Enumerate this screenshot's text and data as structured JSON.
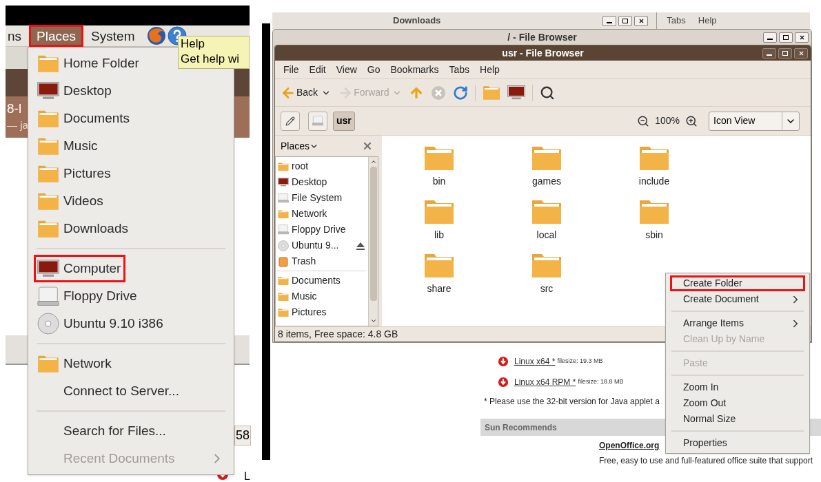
{
  "left_panel": {
    "top_bar": [
      {
        "label": "ns",
        "selected": false,
        "highlighted": false
      },
      {
        "label": "Places",
        "selected": true,
        "highlighted": true
      },
      {
        "label": "System",
        "selected": false,
        "highlighted": false
      }
    ],
    "tooltip": {
      "title": "Help",
      "text": "Get help wi"
    },
    "background": {
      "title_fragment": "8-l",
      "subtitle_fragment": "— ja",
      "number_fragment": "58",
      "letter_fragment": "L"
    },
    "places_menu": {
      "sections": [
        [
          {
            "label": "Home Folder",
            "highlighted": false,
            "disabled": false,
            "submenu": false
          },
          {
            "label": "Desktop",
            "highlighted": false,
            "disabled": false,
            "submenu": false
          },
          {
            "label": "Documents",
            "highlighted": false,
            "disabled": false,
            "submenu": false
          },
          {
            "label": "Music",
            "highlighted": false,
            "disabled": false,
            "submenu": false
          },
          {
            "label": "Pictures",
            "highlighted": false,
            "disabled": false,
            "submenu": false
          },
          {
            "label": "Videos",
            "highlighted": false,
            "disabled": false,
            "submenu": false
          },
          {
            "label": "Downloads",
            "highlighted": false,
            "disabled": false,
            "submenu": false
          }
        ],
        [
          {
            "label": "Computer",
            "highlighted": true,
            "disabled": false,
            "submenu": false
          },
          {
            "label": "Floppy Drive",
            "highlighted": false,
            "disabled": false,
            "submenu": false
          },
          {
            "label": "Ubuntu 9.10 i386",
            "highlighted": false,
            "disabled": false,
            "submenu": false
          }
        ],
        [
          {
            "label": "Network",
            "highlighted": false,
            "disabled": false,
            "submenu": false
          },
          {
            "label": "Connect to Server...",
            "highlighted": false,
            "disabled": false,
            "submenu": false
          }
        ],
        [
          {
            "label": "Search for Files...",
            "highlighted": false,
            "disabled": false,
            "submenu": false
          },
          {
            "label": "Recent Documents",
            "highlighted": false,
            "disabled": true,
            "submenu": true
          }
        ]
      ]
    }
  },
  "file_browser": {
    "background_window": {
      "title": "Downloads",
      "menu": [
        "Tabs",
        "Help"
      ]
    },
    "outer_window": {
      "title": "/ - File Browser"
    },
    "window": {
      "title": "usr - File Browser",
      "menu": [
        "File",
        "Edit",
        "View",
        "Go",
        "Bookmarks",
        "Tabs",
        "Help"
      ],
      "toolbar": [
        {
          "kind": "nav",
          "label": "Back",
          "disabled": false
        },
        {
          "kind": "nav",
          "label": "Forward",
          "disabled": true
        },
        {
          "kind": "icon",
          "disabled": false
        },
        {
          "kind": "icon",
          "disabled": true
        },
        {
          "kind": "icon",
          "disabled": false
        },
        {
          "kind": "separator"
        },
        {
          "kind": "icon",
          "disabled": false
        },
        {
          "kind": "icon",
          "disabled": false
        },
        {
          "kind": "separator"
        },
        {
          "kind": "icon",
          "disabled": false
        }
      ],
      "location": {
        "path": [
          {
            "kind": "drive",
            "selected": false
          },
          {
            "kind": "text",
            "label": "usr",
            "selected": true
          }
        ],
        "zoom": "100%",
        "view": "Icon View"
      },
      "sidebar": {
        "title": "Places",
        "sections": [
          [
            {
              "label": "root",
              "eject": false
            },
            {
              "label": "Desktop",
              "eject": false
            },
            {
              "label": "File System",
              "eject": false
            },
            {
              "label": "Network",
              "eject": false
            },
            {
              "label": "Floppy Drive",
              "eject": false
            },
            {
              "label": "Ubuntu 9...",
              "eject": true
            },
            {
              "label": "Trash",
              "eject": false
            }
          ],
          [
            {
              "label": "Documents",
              "eject": false
            },
            {
              "label": "Music",
              "eject": false
            },
            {
              "label": "Pictures",
              "eject": false
            }
          ]
        ]
      },
      "files": [
        "bin",
        "games",
        "include",
        "lib",
        "local",
        "sbin",
        "share",
        "src"
      ],
      "status_bar": "8 items, Free space: 4.8 GB"
    },
    "context_menu": {
      "sections": [
        [
          {
            "label": "Create Folder",
            "highlighted": true,
            "disabled": false,
            "submenu": false
          },
          {
            "label": "Create Document",
            "highlighted": false,
            "disabled": false,
            "submenu": true
          }
        ],
        [
          {
            "label": "Arrange Items",
            "highlighted": false,
            "disabled": false,
            "submenu": true
          },
          {
            "label": "Clean Up by Name",
            "highlighted": false,
            "disabled": true,
            "submenu": false
          }
        ],
        [
          {
            "label": "Paste",
            "highlighted": false,
            "disabled": true,
            "submenu": false
          }
        ],
        [
          {
            "label": "Zoom In",
            "highlighted": false,
            "disabled": false,
            "submenu": false
          },
          {
            "label": "Zoom Out",
            "highlighted": false,
            "disabled": false,
            "submenu": false
          },
          {
            "label": "Normal Size",
            "highlighted": false,
            "disabled": false,
            "submenu": false
          }
        ],
        [
          {
            "label": "Properties",
            "highlighted": false,
            "disabled": false,
            "submenu": false
          }
        ]
      ]
    }
  },
  "web_page": {
    "downloads": [
      {
        "link": "Linux x64 *",
        "size": "filesize: 19.3 MB"
      },
      {
        "link": "Linux x64 RPM *",
        "size": "filesize: 18.8 MB"
      }
    ],
    "note": "* Please use the 32-bit version for Java applet a",
    "section_title": "Sun Recommends",
    "recommendation": {
      "title": "OpenOffice.org",
      "text": "Free, easy to use and full-featured office suite that support"
    }
  }
}
